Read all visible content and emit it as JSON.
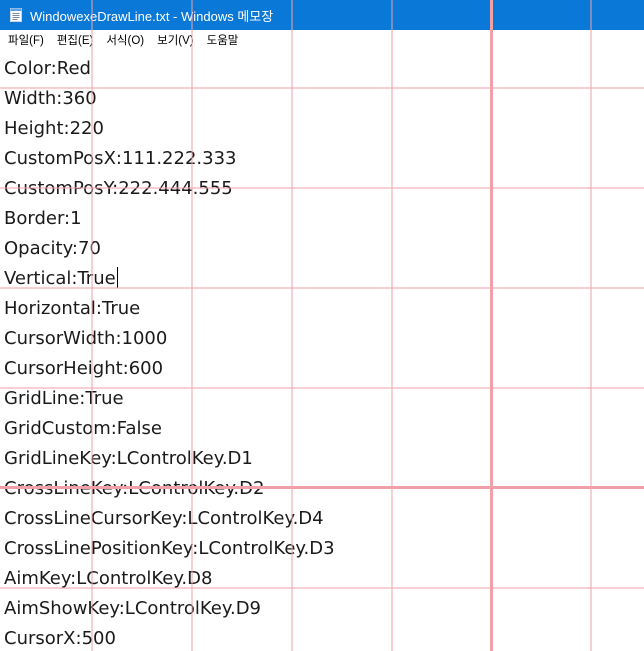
{
  "window": {
    "title": "WindowexeDrawLine.txt - Windows 메모장",
    "titlebar_color": "#0a78d7",
    "icon": "notepad-icon"
  },
  "menubar": {
    "items": [
      {
        "label": "파일(F)"
      },
      {
        "label": "편집(E)"
      },
      {
        "label": "서식(O)"
      },
      {
        "label": "보기(V)"
      },
      {
        "label": "도움말"
      }
    ]
  },
  "editor": {
    "caret_line_index": 7,
    "lines": [
      "Color:Red",
      "Width:360",
      "Height:220",
      "CustomPosX:111.222.333",
      "CustomPosY:222.444.555",
      "Border:1",
      "Opacity:70",
      "Vertical:True",
      "Horizontal:True",
      "CursorWidth:1000",
      "CursorHeight:600",
      "GridLine:True",
      "GridCustom:False",
      "GridLineKey:LControlKey.D1",
      "CrossLineKey:LControlKey.D2",
      "CrossLineCursorKey:LControlKey.D4",
      "CrossLinePositionKey:LControlKey.D3",
      "AimKey:LControlKey.D8",
      "AimShowKey:LControlKey.D9",
      "CursorX:500"
    ]
  },
  "overlay": {
    "line_color": "#f2a0a8"
  }
}
